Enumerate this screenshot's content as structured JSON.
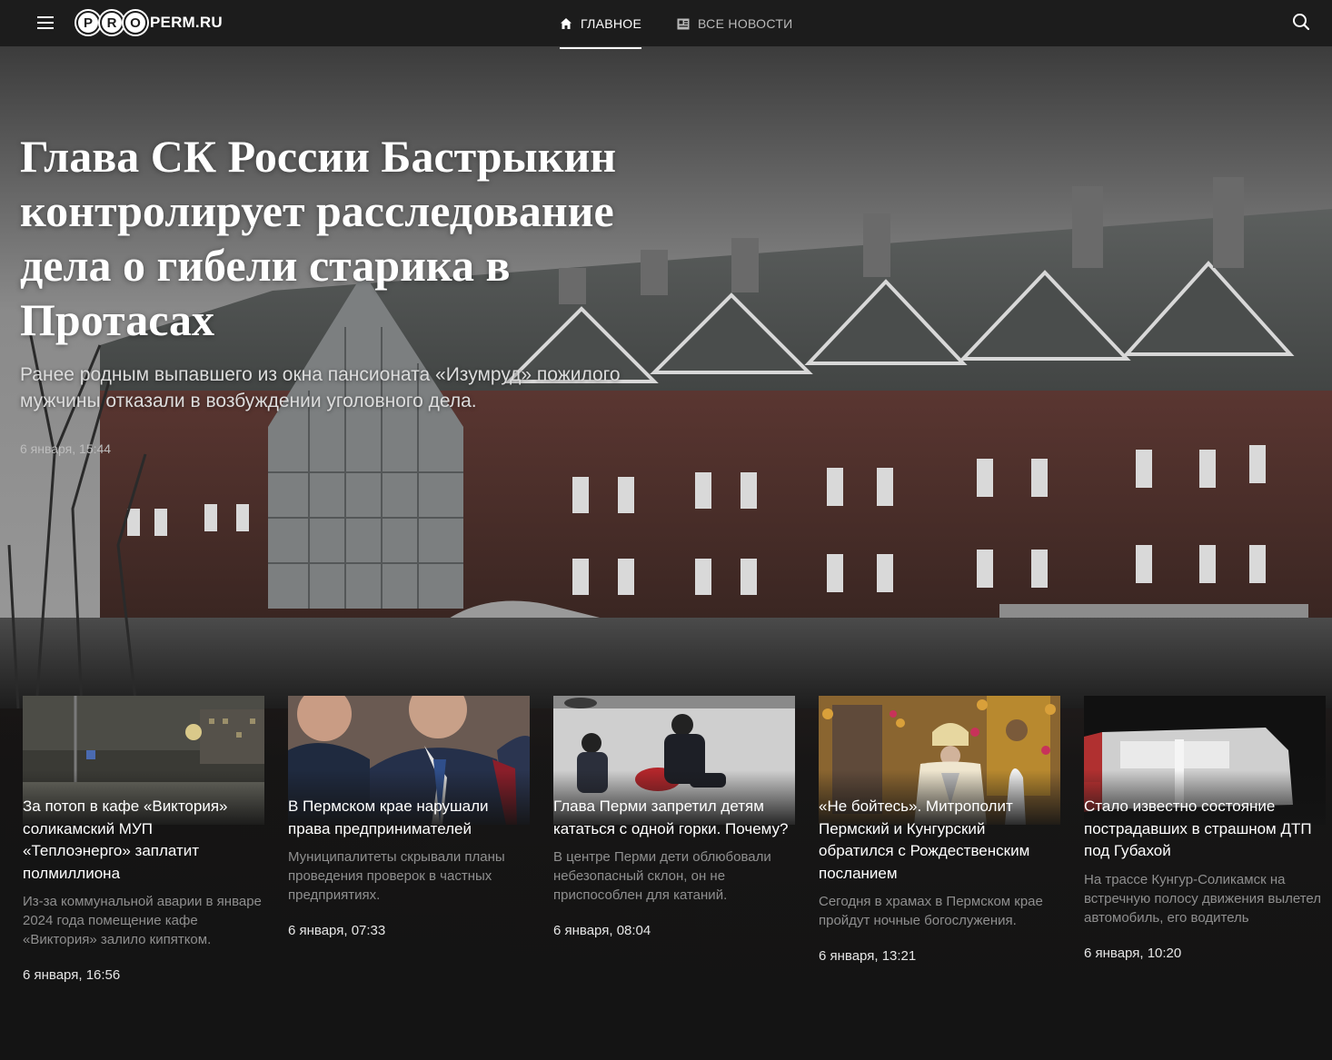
{
  "header": {
    "logo_letters": [
      "P",
      "R",
      "O"
    ],
    "logo_text": "PERM.RU",
    "nav": [
      {
        "label": "ГЛАВНОЕ",
        "icon": "home-icon",
        "active": true
      },
      {
        "label": "ВСЕ НОВОСТИ",
        "icon": "newspaper-icon",
        "active": false
      }
    ]
  },
  "hero": {
    "title": "Глава СК России Бастрыкин контролирует расследование дела о гибели старика в Протасах",
    "lead": "Ранее родным выпавшего из окна пансионата «Изумруд» пожилого мужчины отказали в возбуждении уголовного дела.",
    "date": "6 января, 15:44"
  },
  "cards": [
    {
      "title": "За потоп в кафе «Виктория» соликамский МУП «Теплоэнерго» заплатит полмиллиона",
      "lead": "Из-за коммунальной аварии в январе 2024 года помещение кафе «Виктория» залило кипятком.",
      "date": "6 января, 16:56"
    },
    {
      "title": "В Пермском крае нарушали права предпринимателей",
      "lead": "Муниципалитеты скрывали планы проведения проверок в частных предприятиях.",
      "date": "6 января, 07:33"
    },
    {
      "title": "Глава Перми запретил детям кататься с одной горки. Почему?",
      "lead": "В центре Перми дети облюбовали небезопасный склон, он не приспособлен для катаний.",
      "date": "6 января, 08:04"
    },
    {
      "title": "«Не бойтесь». Митрополит Пермский и Кунгурский обратился с Рождественским посланием",
      "lead": "Сегодня в храмах в Пермском крае пройдут ночные богослужения.",
      "date": "6 января, 13:21"
    },
    {
      "title": "Стало известно состояние пострадавших в страшном ДТП под Губахой",
      "lead": "На трассе Кунгур-Соликамск на встречную полосу движения вылетел автомобиль, его водитель",
      "date": "6 января, 10:20"
    }
  ]
}
